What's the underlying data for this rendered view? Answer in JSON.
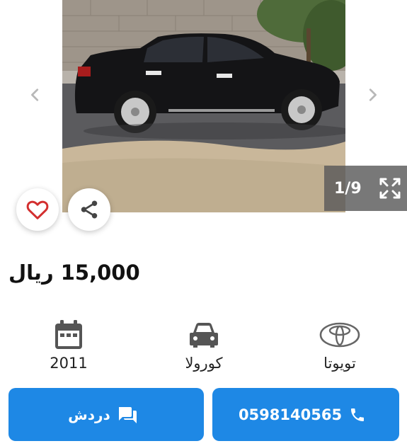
{
  "gallery": {
    "counter": "1/9",
    "image_description": "black sedan parked beside a wall"
  },
  "listing": {
    "price": "15,000 ريال"
  },
  "specs": {
    "year": "2011",
    "model": "كورولا",
    "make": "تويوتا"
  },
  "actions": {
    "chat_label": "دردش",
    "phone_number": "0598140565"
  },
  "colors": {
    "accent": "#1e88e5",
    "favorite": "#d32f2f"
  },
  "icons": [
    "chevron-left-icon",
    "chevron-right-icon",
    "fullscreen-icon",
    "heart-icon",
    "share-icon",
    "calendar-icon",
    "car-icon",
    "toyota-logo-icon",
    "chat-icon",
    "phone-icon"
  ]
}
